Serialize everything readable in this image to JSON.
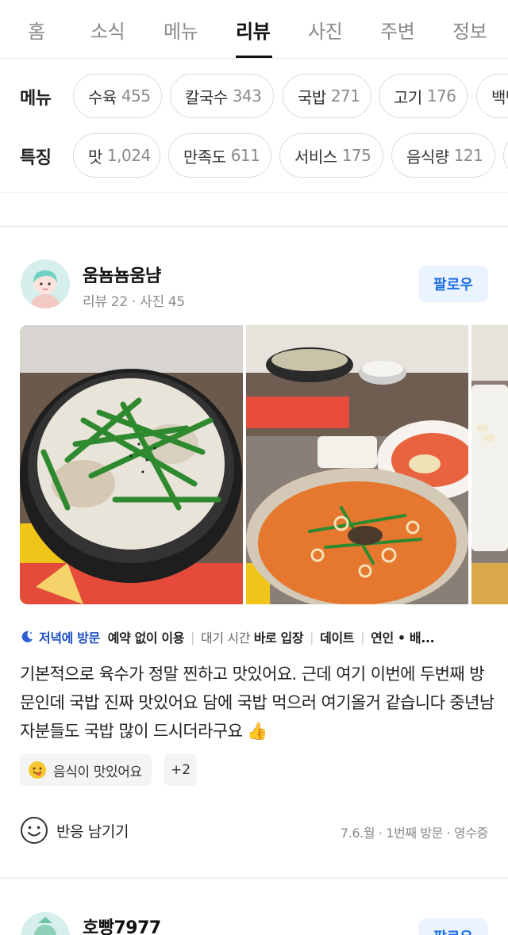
{
  "tabs": [
    {
      "label": "홈"
    },
    {
      "label": "소식"
    },
    {
      "label": "메뉴"
    },
    {
      "label": "리뷰",
      "active": true
    },
    {
      "label": "사진"
    },
    {
      "label": "주변"
    },
    {
      "label": "정보"
    }
  ],
  "filters": {
    "menu": {
      "label": "메뉴",
      "chips": [
        {
          "name": "수육",
          "count": "455"
        },
        {
          "name": "칼국수",
          "count": "343"
        },
        {
          "name": "국밥",
          "count": "271"
        },
        {
          "name": "고기",
          "count": "176"
        },
        {
          "name": "백반",
          "count": ""
        }
      ]
    },
    "feature": {
      "label": "특징",
      "chips": [
        {
          "name": "맛",
          "count": "1,024"
        },
        {
          "name": "만족도",
          "count": "611"
        },
        {
          "name": "서비스",
          "count": "175"
        },
        {
          "name": "음식량",
          "count": "121"
        }
      ]
    }
  },
  "reviews": [
    {
      "nickname": "움뇸뇸움냠",
      "stats": "리뷰 22 · 사진 45",
      "follow_label": "팔로우",
      "visit_time": "저녁에 방문",
      "tags": [
        "예약 없이 이용",
        "대기 시간 바로 입장",
        "데이트",
        "연인 • 배…"
      ],
      "tag_parts": [
        {
          "prefix": "",
          "bold": "예약 없이 이용"
        },
        {
          "prefix": "대기 시간 ",
          "bold": "바로 입장"
        },
        {
          "prefix": "",
          "bold": "데이트"
        },
        {
          "prefix": "",
          "bold": "연인 • 배..."
        }
      ],
      "body": "기본적으로 육수가 정말 찐하고 맛있어요. 근데 여기 이번에 두번째 방문인데 국밥 진짜 맛있어요 담에 국밥 먹으러 여기올거 같습니다 중년남자분들도 국밥 많이 드시더라구요 👍",
      "keyword": "음식이 맛있어요",
      "keyword_more": "+2",
      "react_label": "반응 남기기",
      "meta": "7.6.월 · 1번째 방문 · 영수증"
    },
    {
      "nickname": "호빵7977",
      "follow_label": "팔로우"
    }
  ]
}
